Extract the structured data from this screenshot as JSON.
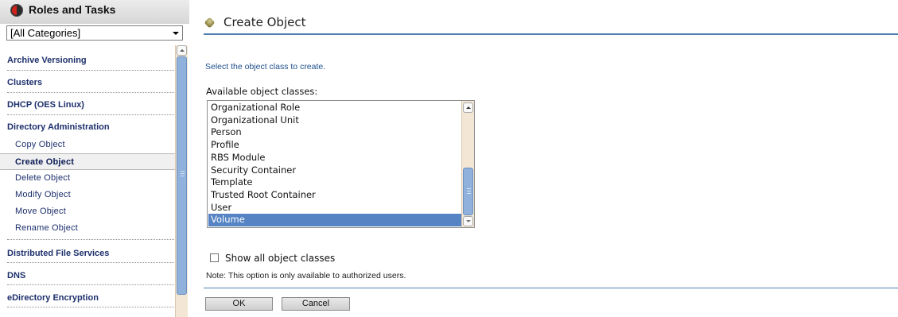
{
  "sidebar": {
    "title": "Roles and Tasks",
    "category_select": {
      "selected": "[All Categories]"
    },
    "categories": [
      {
        "label": "Archive Versioning"
      },
      {
        "label": "Clusters"
      },
      {
        "label": "DHCP (OES Linux)"
      },
      {
        "label": "Directory Administration",
        "tasks": [
          {
            "label": "Copy Object"
          },
          {
            "label": "Create Object",
            "active": true
          },
          {
            "label": "Delete Object"
          },
          {
            "label": "Modify Object"
          },
          {
            "label": "Move Object"
          },
          {
            "label": "Rename Object"
          }
        ]
      },
      {
        "label": "Distributed File Services"
      },
      {
        "label": "DNS"
      },
      {
        "label": "eDirectory Encryption"
      }
    ]
  },
  "main": {
    "title": "Create Object",
    "instruction": "Select the object class to create.",
    "list_label": "Available object classes:",
    "object_classes": [
      "Organizational Role",
      "Organizational Unit",
      "Person",
      "Profile",
      "RBS Module",
      "Security Container",
      "Template",
      "Trusted Root Container",
      "User",
      "Volume"
    ],
    "selected_class": "Volume",
    "show_all_checkbox": {
      "label": "Show all object classes",
      "checked": false
    },
    "note": "Note: This option is only available to authorized users.",
    "buttons": {
      "ok": "OK",
      "cancel": "Cancel"
    }
  },
  "colors": {
    "accent_rule": "#4e7fb0",
    "selection": "#5583c3",
    "nav_text": "#1c2f6b",
    "instruction_text": "#1e4e8b"
  }
}
